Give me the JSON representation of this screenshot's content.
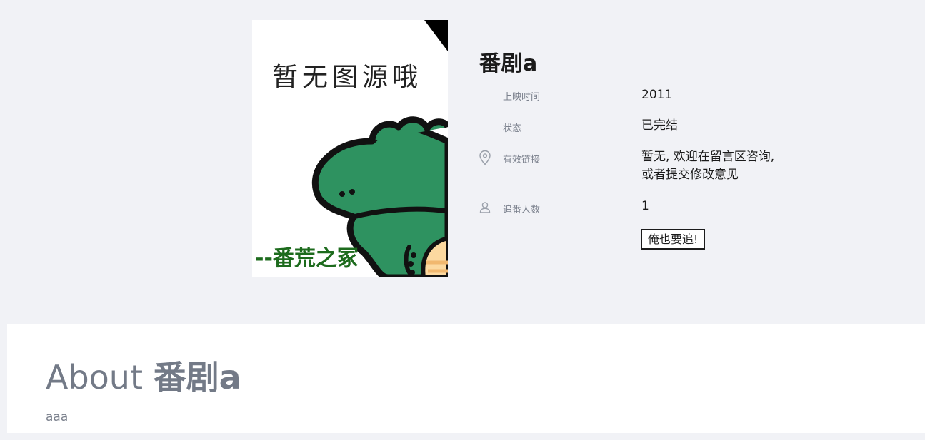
{
  "show": {
    "title": "番剧a",
    "poster": {
      "top_text": "暂无图源哦",
      "bottom_text": "--番荒之冢"
    },
    "info": {
      "release": {
        "label": "上映时间",
        "value": "2011"
      },
      "status": {
        "label": "状态",
        "value": "已完结"
      },
      "links": {
        "label": "有效链接",
        "value_line1": "暂无, 欢迎在留言区咨询,",
        "value_line2": "或者提交修改意见"
      },
      "followers": {
        "label": "追番人数",
        "value": "1"
      }
    },
    "follow_button_label": "俺也要追!"
  },
  "about": {
    "prefix": "About",
    "name": "番剧a",
    "description": "aaa"
  },
  "colors": {
    "page_bg": "#f1f2f6",
    "text_dark": "#1b1b1b",
    "text_muted": "#7b818d",
    "crocodile_green": "#2e9260",
    "caption_green": "#1d6b1d"
  },
  "icons": [
    "location-pin-icon",
    "user-icon"
  ]
}
